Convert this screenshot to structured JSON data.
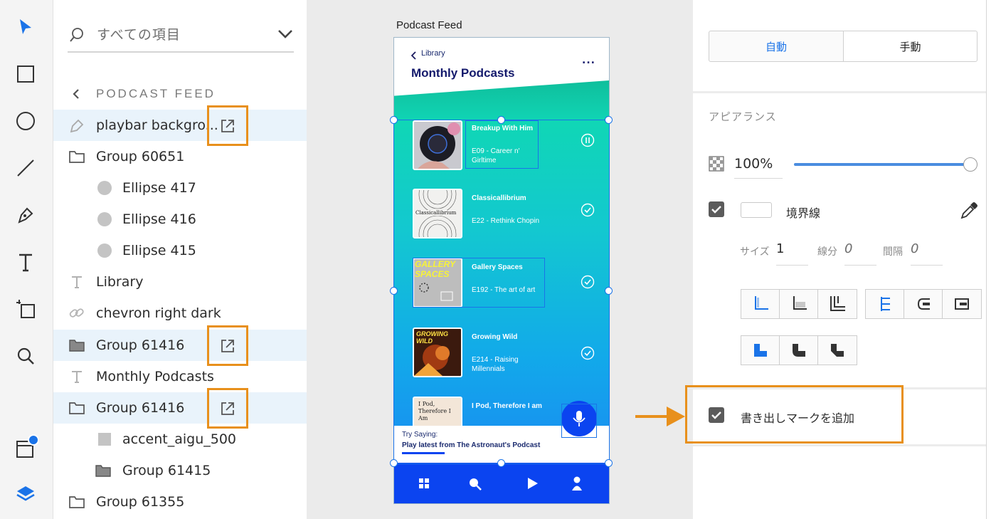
{
  "layers_panel": {
    "search": {
      "placeholder": "すべての項目"
    },
    "breadcrumb": "PODCAST FEED",
    "items": [
      {
        "label": "playbar backgro..."
      },
      {
        "label": "Group 60651"
      },
      {
        "label": "Ellipse 417"
      },
      {
        "label": "Ellipse 416"
      },
      {
        "label": "Ellipse 415"
      },
      {
        "label": "Library"
      },
      {
        "label": "chevron right dark"
      },
      {
        "label": "Group 61416"
      },
      {
        "label": "Monthly Podcasts"
      },
      {
        "label": "Group 61416"
      },
      {
        "label": "accent_aigu_500"
      },
      {
        "label": "Group 61415"
      },
      {
        "label": "Group 61355"
      }
    ]
  },
  "canvas": {
    "artboard_title": "Podcast Feed",
    "app": {
      "back_label": "Library",
      "title": "Monthly Podcasts",
      "more": "...",
      "episodes": [
        {
          "title": "Breakup With Him",
          "subtitle": "E09 - Career n' Girltime",
          "status": "pause"
        },
        {
          "title": "Classicallibrium",
          "subtitle": "E22 - Rethink Chopin",
          "status": "check",
          "art_text": "Classicallibrium"
        },
        {
          "title": "Gallery Spaces",
          "subtitle": "E192 - The art of art",
          "status": "check",
          "art_text": "GALLERY SPACES"
        },
        {
          "title": "Growing Wild",
          "subtitle": "E214 - Raising Millennials",
          "status": "check",
          "art_text": "GROWING WILD"
        },
        {
          "title": "I Pod, Therefore I am",
          "subtitle": "",
          "status": "",
          "art_text": "I Pod, Therefore I Am"
        }
      ],
      "try_saying": "Try Saying:",
      "voice_command": "Play latest from The Astronaut's Podcast"
    }
  },
  "properties_panel": {
    "modes": [
      "自動",
      "手動"
    ],
    "appearance_title": "アピアランス",
    "opacity": "100%",
    "opacity_level": 1.0,
    "stroke_label": "境界線",
    "size_label": "サイズ",
    "size_value": "1",
    "dash_label": "線分",
    "dash_value": "0",
    "gap_label": "間隔",
    "gap_value": "0",
    "export_mark_label": "書き出しマークを追加"
  },
  "colors": {
    "accent": "#1a73e8",
    "highlight": "#e8901c",
    "app_blue": "#0b44f0"
  }
}
